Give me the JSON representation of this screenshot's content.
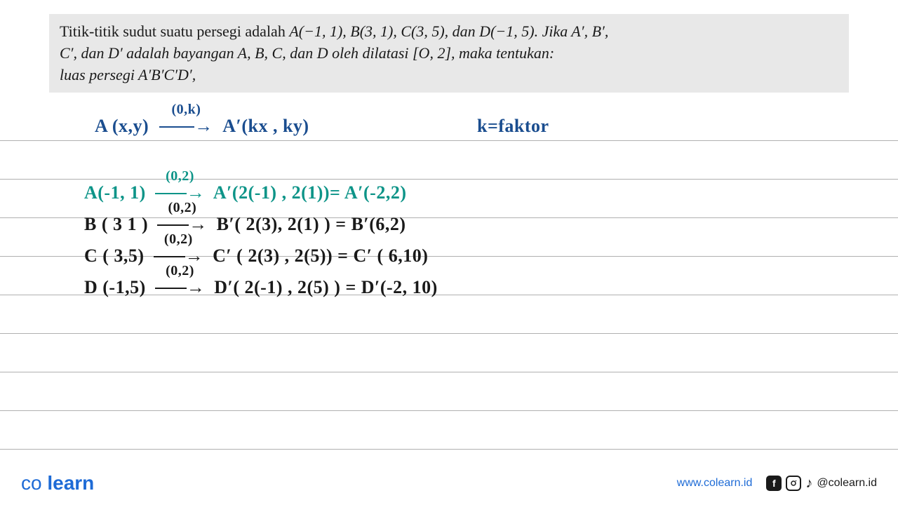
{
  "problem": {
    "line1_prefix": "Titik-titik sudut suatu persegi adalah ",
    "line1_points": "A(−1, 1), B(3, 1), C(3, 5), dan D(−1, 5). Jika A′, B′,",
    "line2_prefix": "C′, dan D′ adalah bayangan A, B, C, dan D oleh dilatasi [O, 2], maka tentukan:",
    "line3": " luas persegi A′B′C′D′,"
  },
  "work": {
    "rule_blue_left": "A (x,y)",
    "rule_blue_arrow_label": "(0,k)",
    "rule_blue_arrow": "→",
    "rule_blue_right": "A′(kx , ky)",
    "rule_blue_factor": "k=faktor",
    "line_a_left": "A(-1, 1)",
    "line_a_arrow_label": "(0,2)",
    "line_a_arrow": "→",
    "line_a_right": "A′(2(-1) , 2(1))= A′(-2,2)",
    "line_b_left": "B ( 3  1 )",
    "line_b_arrow_label": "(0,2)",
    "line_b_arrow": "→",
    "line_b_right": "B′( 2(3), 2(1) ) = B′(6,2)",
    "line_c_left": "C ( 3,5)",
    "line_c_arrow_label": "(0,2)",
    "line_c_arrow": "→",
    "line_c_right": "C′ ( 2(3) , 2(5)) = C′ ( 6,10)",
    "line_d_left": "D (-1,5)",
    "line_d_arrow_label": "(0,2)",
    "line_d_arrow": "→",
    "line_d_right": "D′( 2(-1) , 2(5) ) = D′(-2, 10)"
  },
  "footer": {
    "logo_co": "co",
    "logo_learn": "learn",
    "website": "www.colearn.id",
    "handle": "@colearn.id"
  }
}
